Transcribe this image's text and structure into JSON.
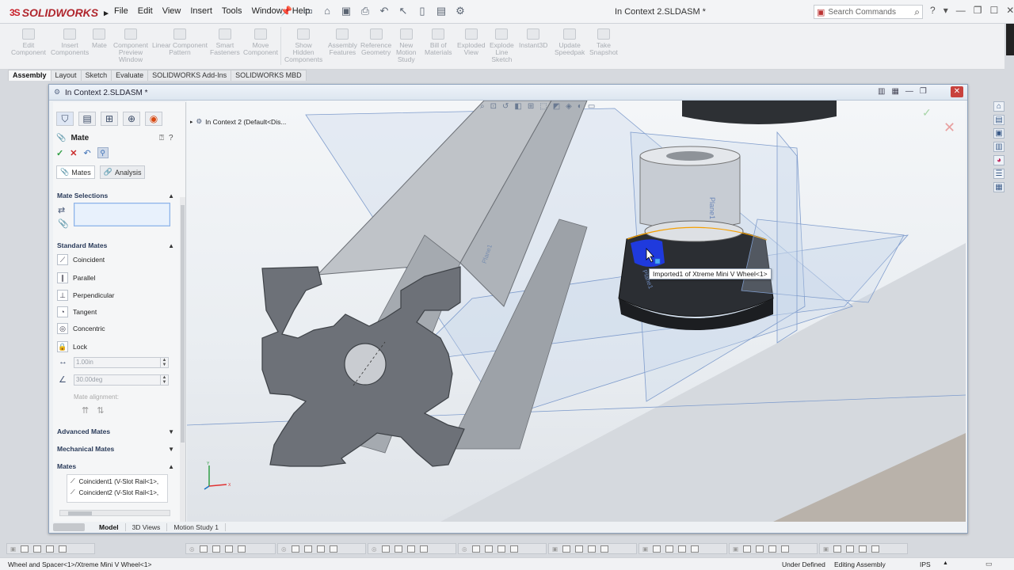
{
  "app": {
    "brand": "SOLIDWORKS",
    "doc_title": "In Context 2.SLDASM *"
  },
  "menu": [
    "File",
    "Edit",
    "View",
    "Insert",
    "Tools",
    "Window",
    "Help"
  ],
  "search": {
    "placeholder": "Search Commands"
  },
  "commands": [
    {
      "label": "Edit\nComponent"
    },
    {
      "label": "Insert\nComponents"
    },
    {
      "label": "Mate"
    },
    {
      "label": "Component\nPreview\nWindow"
    },
    {
      "label": "Linear Component\nPattern"
    },
    {
      "label": "Smart\nFasteners"
    },
    {
      "label": "Move\nComponent"
    },
    {
      "label": "Show\nHidden\nComponents"
    },
    {
      "label": "Assembly\nFeatures"
    },
    {
      "label": "Reference\nGeometry"
    },
    {
      "label": "New\nMotion\nStudy"
    },
    {
      "label": "Bill of\nMaterials"
    },
    {
      "label": "Exploded\nView"
    },
    {
      "label": "Explode\nLine\nSketch"
    },
    {
      "label": "Instant3D"
    },
    {
      "label": "Update\nSpeedpak"
    },
    {
      "label": "Take\nSnapshot"
    }
  ],
  "ribbon_tabs": [
    "Assembly",
    "Layout",
    "Sketch",
    "Evaluate",
    "SOLIDWORKS Add-Ins",
    "SOLIDWORKS MBD"
  ],
  "doc_window": {
    "title": "In Context 2.SLDASM *"
  },
  "property_manager": {
    "title": "Mate",
    "subtabs": [
      "Mates",
      "Analysis"
    ],
    "sections": {
      "mate_selections": "Mate Selections",
      "standard_mates": "Standard Mates",
      "advanced_mates": "Advanced Mates",
      "mechanical_mates": "Mechanical Mates",
      "mates": "Mates"
    },
    "standard_mates": [
      "Coincident",
      "Parallel",
      "Perpendicular",
      "Tangent",
      "Concentric",
      "Lock"
    ],
    "distance": "1.00in",
    "angle": "30.00deg",
    "mate_alignment": "Mate alignment:",
    "mates_list": [
      "Coincident1 (V-Slot Rail<1>,",
      "Coincident2 (V-Slot Rail<1>,"
    ]
  },
  "bottom_tabs": [
    "Model",
    "3D Views",
    "Motion Study 1"
  ],
  "tree_root": "In Context 2  (Default<Dis...",
  "tooltip": "Imported1 of Xtreme Mini V Wheel<1>",
  "plane_labels": [
    "Plane1",
    "Plane1",
    "Plane1"
  ],
  "status": {
    "left": "Wheel and Spacer<1>/Xtreme Mini V Wheel<1>",
    "definition": "Under Defined",
    "mode": "Editing Assembly",
    "units": "IPS"
  },
  "colors": {
    "accent": "#3b6fb6",
    "brand": "#c8202a",
    "selection": "#1e3cf0"
  }
}
